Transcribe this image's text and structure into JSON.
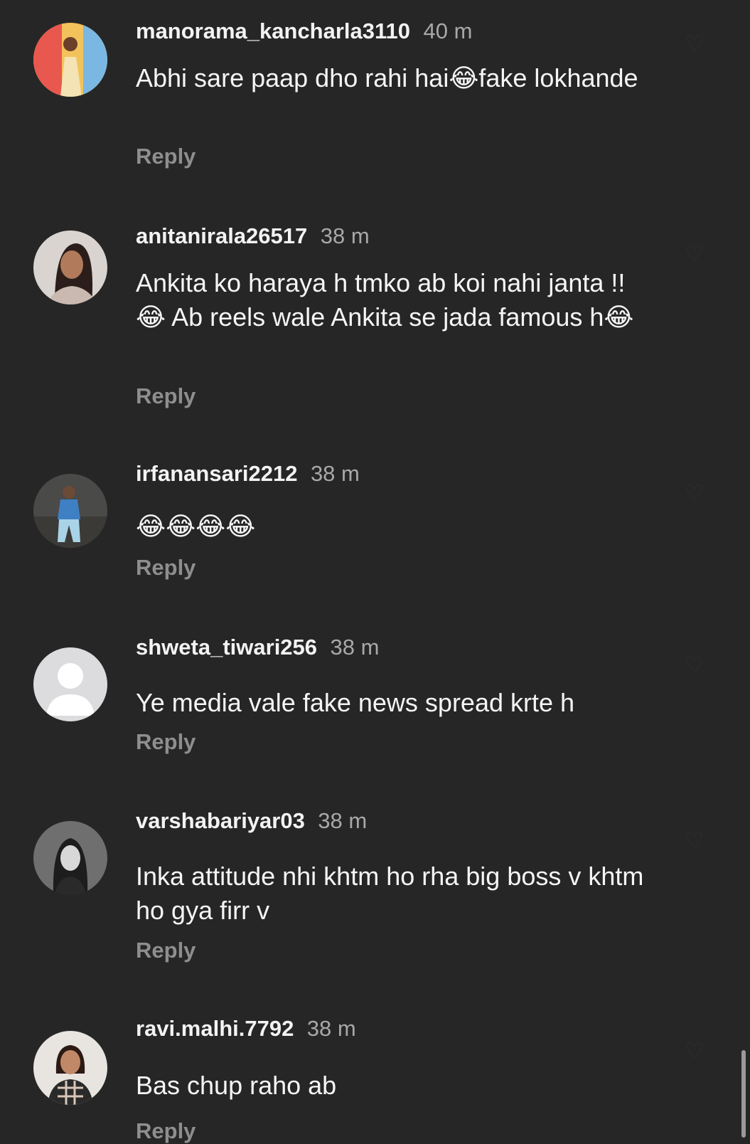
{
  "comments": [
    {
      "username": "manorama_kancharla3110",
      "time": "40 m",
      "text": "Abhi sare paap dho rahi hai😂fake lokhande",
      "reply": "Reply",
      "avatar": "profile-photo"
    },
    {
      "username": "anitanirala26517",
      "time": "38 m",
      "text": "Ankita ko haraya h tmko ab koi nahi janta !! 😂 Ab reels wale Ankita se jada famous h😂",
      "reply": "Reply",
      "avatar": "profile-photo"
    },
    {
      "username": "irfanansari2212",
      "time": "38 m",
      "text": "😂😂😂😂",
      "reply": "Reply",
      "avatar": "profile-photo"
    },
    {
      "username": "shweta_tiwari256",
      "time": "38 m",
      "text": "Ye media vale fake news spread krte h",
      "reply": "Reply",
      "avatar": "default-user-icon"
    },
    {
      "username": "varshabariyar03",
      "time": "38 m",
      "text": "Inka attitude nhi khtm ho rha big boss v khtm ho gya firr v",
      "reply": "Reply",
      "avatar": "profile-photo"
    },
    {
      "username": "ravi.malhi.7792",
      "time": "38 m",
      "text": "Bas chup raho ab",
      "reply": "Reply",
      "avatar": "profile-photo"
    }
  ]
}
